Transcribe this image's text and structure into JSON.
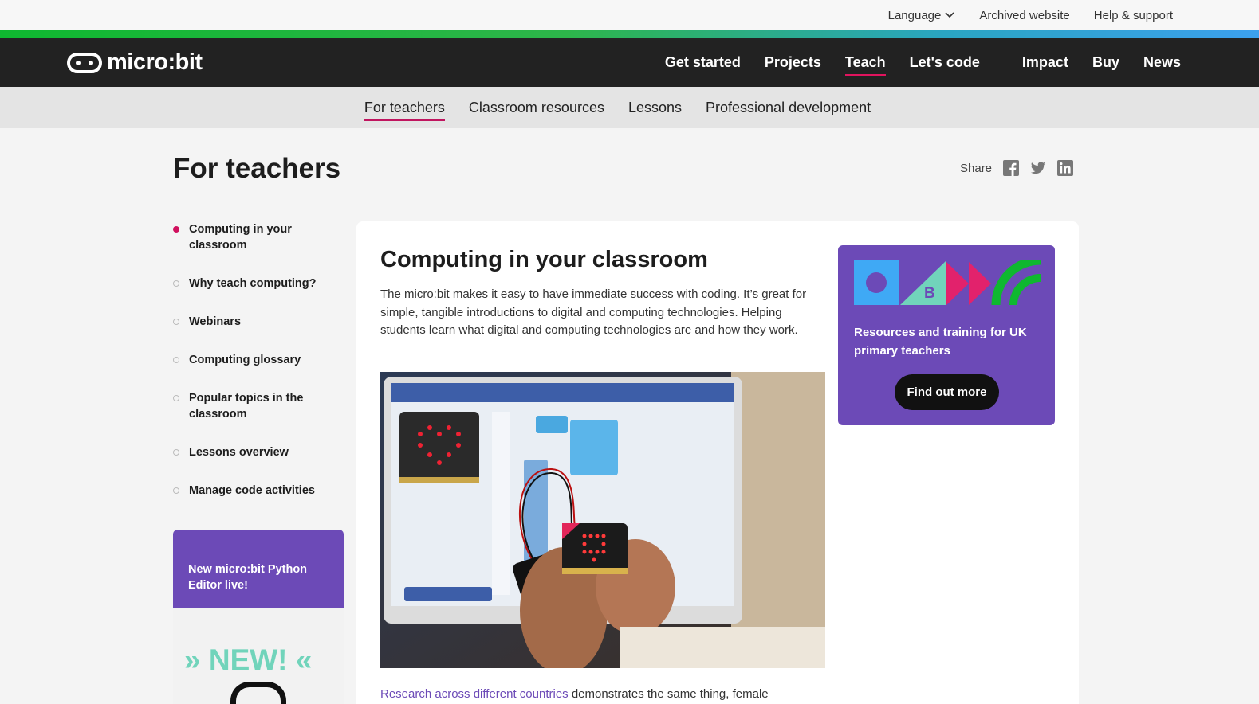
{
  "utility": {
    "language": "Language",
    "archived": "Archived website",
    "help": "Help & support"
  },
  "brand": {
    "name": "micro:bit"
  },
  "mainnav": {
    "items": [
      "Get started",
      "Projects",
      "Teach",
      "Let's code",
      "Impact",
      "Buy",
      "News"
    ],
    "active": "Teach"
  },
  "subnav": {
    "items": [
      "For teachers",
      "Classroom resources",
      "Lessons",
      "Professional development"
    ],
    "active": "For teachers"
  },
  "page": {
    "title": "For teachers",
    "share_label": "Share"
  },
  "sidebar": {
    "items": [
      "Computing in your classroom",
      "Why teach computing?",
      "Webinars",
      "Computing glossary",
      "Popular topics in the classroom",
      "Lessons overview",
      "Manage code activities"
    ],
    "promo_text": "New micro:bit Python Editor live!",
    "promo_image_text": "» NEW! «"
  },
  "content": {
    "heading": "Computing in your classroom",
    "intro": "The micro:bit makes it easy to have immediate success with coding. It’s great for simple, tangible introductions to digital and computing technologies. Helping students learn what digital and computing technologies are and how they work.",
    "foot_link": "Research across different countries",
    "foot_rest": " demonstrates the same thing, female"
  },
  "resource_box": {
    "text": "Resources and training for UK primary teachers",
    "button": "Find out more",
    "shape_letter": "B"
  },
  "colors": {
    "accent_pink": "#e1145e",
    "purple": "#6c4ab7",
    "nav_bg": "#222222",
    "link": "#6c4ab7"
  }
}
